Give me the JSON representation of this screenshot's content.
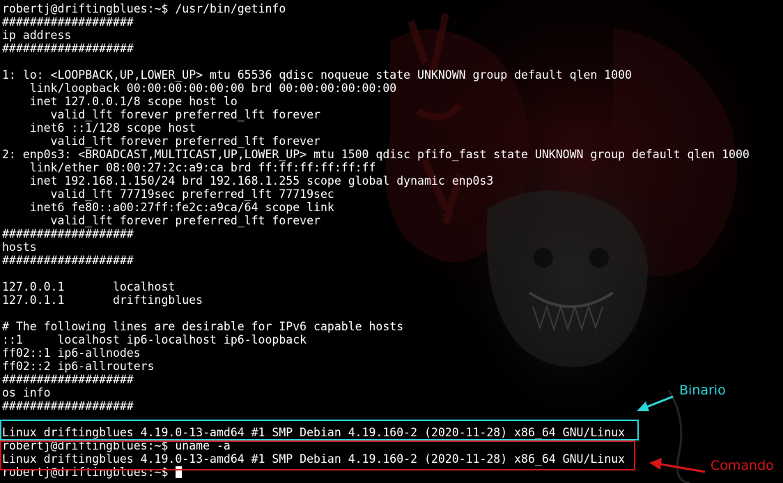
{
  "terminal": {
    "lines": [
      "robertj@driftingblues:~$ /usr/bin/getinfo",
      "###################",
      "ip address",
      "###################",
      "",
      "1: lo: <LOOPBACK,UP,LOWER_UP> mtu 65536 qdisc noqueue state UNKNOWN group default qlen 1000",
      "    link/loopback 00:00:00:00:00:00 brd 00:00:00:00:00:00",
      "    inet 127.0.0.1/8 scope host lo",
      "       valid_lft forever preferred_lft forever",
      "    inet6 ::1/128 scope host",
      "       valid_lft forever preferred_lft forever",
      "2: enp0s3: <BROADCAST,MULTICAST,UP,LOWER_UP> mtu 1500 qdisc pfifo_fast state UNKNOWN group default qlen 1000",
      "    link/ether 08:00:27:2c:a9:ca brd ff:ff:ff:ff:ff:ff",
      "    inet 192.168.1.150/24 brd 192.168.1.255 scope global dynamic enp0s3",
      "       valid_lft 77719sec preferred_lft 77719sec",
      "    inet6 fe80::a00:27ff:fe2c:a9ca/64 scope link",
      "       valid_lft forever preferred_lft forever",
      "###################",
      "hosts",
      "###################",
      "",
      "127.0.0.1       localhost",
      "127.0.1.1       driftingblues",
      "",
      "# The following lines are desirable for IPv6 capable hosts",
      "::1     localhost ip6-localhost ip6-loopback",
      "ff02::1 ip6-allnodes",
      "ff02::2 ip6-allrouters",
      "###################",
      "os info",
      "###################",
      "",
      "Linux driftingblues 4.19.0-13-amd64 #1 SMP Debian 4.19.160-2 (2020-11-28) x86_64 GNU/Linux",
      "robertj@driftingblues:~$ uname -a",
      "Linux driftingblues 4.19.0-13-amd64 #1 SMP Debian 4.19.160-2 (2020-11-28) x86_64 GNU/Linux",
      "robertj@driftingblues:~$ "
    ]
  },
  "annotations": {
    "binario_label": "Binario",
    "comando_label": "Comando"
  },
  "colors": {
    "background": "#000000",
    "text": "#ffffff",
    "binario_accent": "#2cd6dc",
    "comando_accent": "#d8141b",
    "wallpaper_accent": "#3a0a0a"
  },
  "icons": {
    "cursor": "block-cursor-icon",
    "binario_arrow": "arrow-icon",
    "comando_arrow": "arrow-icon"
  }
}
